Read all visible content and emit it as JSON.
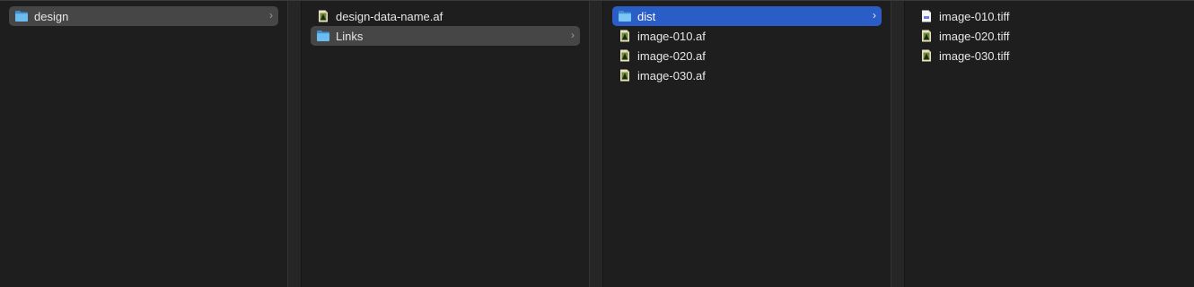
{
  "columns": [
    {
      "items": [
        {
          "label": "design",
          "icon": "folder-icon",
          "has_children": true,
          "chevron": "›",
          "selected": "inactive"
        }
      ]
    },
    {
      "items": [
        {
          "label": "design-data-name.af",
          "icon": "affinity-file-icon",
          "has_children": false
        },
        {
          "label": "Links",
          "icon": "folder-icon",
          "has_children": true,
          "chevron": "›",
          "selected": "inactive"
        }
      ]
    },
    {
      "items": [
        {
          "label": "dist",
          "icon": "folder-icon",
          "has_children": true,
          "chevron": "›",
          "selected": "active"
        },
        {
          "label": "image-010.af",
          "icon": "affinity-file-icon",
          "has_children": false
        },
        {
          "label": "image-020.af",
          "icon": "affinity-file-icon",
          "has_children": false
        },
        {
          "label": "image-030.af",
          "icon": "affinity-file-icon",
          "has_children": false
        }
      ]
    },
    {
      "items": [
        {
          "label": "image-010.tiff",
          "icon": "document-icon",
          "has_children": false
        },
        {
          "label": "image-020.tiff",
          "icon": "affinity-file-icon",
          "has_children": false
        },
        {
          "label": "image-030.tiff",
          "icon": "affinity-file-icon",
          "has_children": false
        }
      ]
    }
  ],
  "colors": {
    "background": "#1e1e1e",
    "selection_active": "#2b5dc7",
    "selection_inactive": "#464646",
    "folder": "#5aaeea",
    "text": "#e6e6e6"
  }
}
